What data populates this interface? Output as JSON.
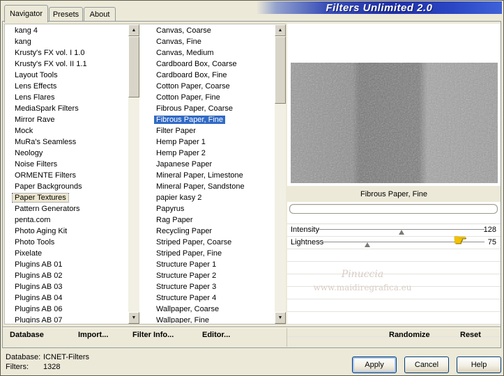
{
  "titlebar": {
    "title": "Filters Unlimited 2.0"
  },
  "tabs": {
    "navigator": "Navigator",
    "presets": "Presets",
    "about": "About"
  },
  "navigator_list": {
    "selected_index": 15,
    "items": [
      "kang 4",
      "kang",
      "Krusty's FX vol. I 1.0",
      "Krusty's FX vol. II 1.1",
      "Layout Tools",
      "Lens Effects",
      "Lens Flares",
      "MediaSpark Filters",
      "Mirror Rave",
      "Mock",
      "MuRa's Seamless",
      "Neology",
      "Noise Filters",
      "ORMENTE Filters",
      "Paper Backgrounds",
      "Paper Textures",
      "Pattern Generators",
      "penta.com",
      "Photo Aging Kit",
      "Photo Tools",
      "Pixelate",
      "Plugins AB 01",
      "Plugins AB 02",
      "Plugins AB 03",
      "Plugins AB 04",
      "Plugins AB 06",
      "Plugins AB 07"
    ]
  },
  "filter_list": {
    "selected_index": 8,
    "items": [
      "Canvas, Coarse",
      "Canvas, Fine",
      "Canvas, Medium",
      "Cardboard Box, Coarse",
      "Cardboard Box, Fine",
      "Cotton Paper, Coarse",
      "Cotton Paper, Fine",
      "Fibrous Paper, Coarse",
      "Fibrous Paper, Fine",
      "Filter Paper",
      "Hemp Paper 1",
      "Hemp Paper 2",
      "Japanese Paper",
      "Mineral Paper, Limestone",
      "Mineral Paper, Sandstone",
      "papier kasy 2",
      "Papyrus",
      "Rag Paper",
      "Recycling Paper",
      "Striped Paper, Coarse",
      "Striped Paper, Fine",
      "Structure Paper 1",
      "Structure Paper 2",
      "Structure Paper 3",
      "Structure Paper 4",
      "Wallpaper, Coarse",
      "Wallpaper, Fine"
    ]
  },
  "preview": {
    "caption": "Fibrous Paper, Fine"
  },
  "controls": {
    "rows": [
      {
        "label": "Intensity",
        "value": 128,
        "max": 255
      },
      {
        "label": "Lightness",
        "value": 75,
        "max": 255
      }
    ]
  },
  "watermark": {
    "line1": "Pinuccia",
    "line2": "www.maidiregrafica.eu"
  },
  "toolbar": {
    "database": "Database",
    "import": "Import...",
    "filter_info": "Filter Info...",
    "editor": "Editor...",
    "randomize": "Randomize",
    "reset": "Reset"
  },
  "statusbar": {
    "database_label": "Database:",
    "database_value": "ICNET-Filters",
    "filters_label": "Filters:",
    "filters_value": "1328"
  },
  "buttons": {
    "apply": "Apply",
    "cancel": "Cancel",
    "help": "Help"
  },
  "icons": {
    "scroll_up": "▲",
    "scroll_down": "▼",
    "pointing_hand": "☛"
  },
  "colors": {
    "selection": "#316AC5",
    "hand_yellow": "#F2C200",
    "titlebar_blue": "#1F2FA6"
  }
}
